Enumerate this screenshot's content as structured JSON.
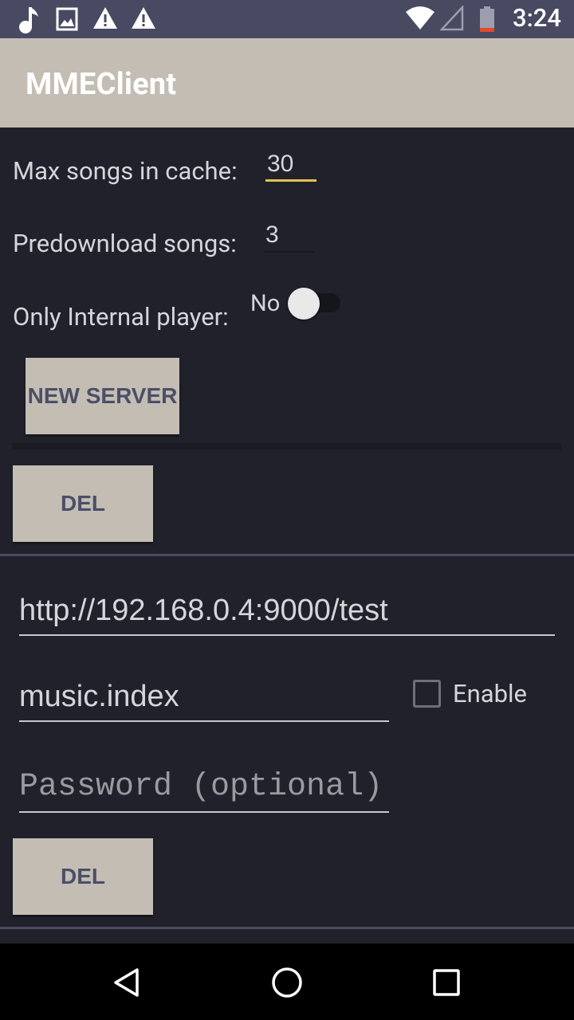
{
  "status_bar": {
    "time": "3:24",
    "icons": [
      "music-note-icon",
      "image-icon",
      "warning-icon",
      "warning-icon",
      "wifi-icon",
      "cellular-signal-icon",
      "battery-low-icon"
    ]
  },
  "app_bar": {
    "title": "MMEClient"
  },
  "settings": {
    "max_songs_label": "Max songs in cache:",
    "max_songs_value": "30",
    "predownload_label": "Predownload songs:",
    "predownload_value": "3",
    "internal_player_label": "Only Internal player:",
    "internal_player_state": "No"
  },
  "buttons": {
    "new_server": "NEW SERVER",
    "del": "DEL"
  },
  "server": {
    "url": "http://192.168.0.4:9000/test",
    "index_file": "music.index",
    "enable_label": "Enable",
    "password_placeholder": "Password (optional)"
  },
  "nav_bar": {
    "icons": [
      "back-icon",
      "home-icon",
      "recents-icon"
    ]
  },
  "colors": {
    "status_bar": "#474a61",
    "app_bar": "#c4bdb3",
    "background": "#20212b",
    "accent": "#e3c14f",
    "button_text": "#4b4f68"
  }
}
